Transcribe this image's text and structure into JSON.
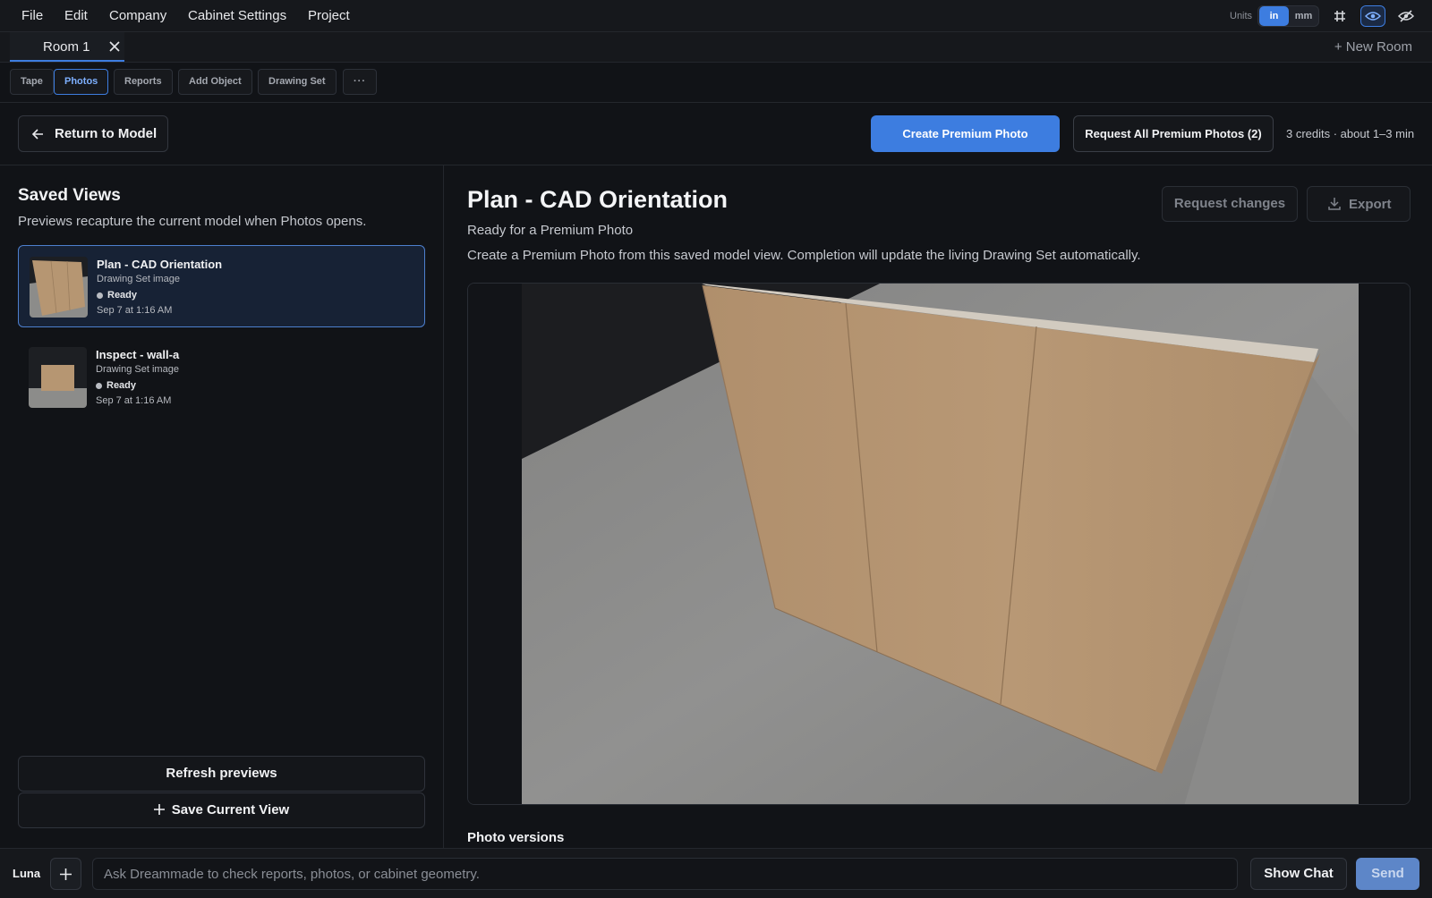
{
  "menu": {
    "items": [
      "File",
      "Edit",
      "Company",
      "Cabinet Settings",
      "Project"
    ]
  },
  "units": {
    "label": "Units",
    "options": [
      "in",
      "mm"
    ],
    "selected": "in"
  },
  "top_icons": [
    "grid-icon",
    "eye-icon",
    "eye-off-icon"
  ],
  "rooms": {
    "active_tab": "Room 1",
    "new_room": "+ New Room"
  },
  "tools": {
    "items": [
      "Tape",
      "Photos",
      "Reports",
      "Add Object",
      "Drawing Set"
    ],
    "active": "Photos",
    "more": "···"
  },
  "actions": {
    "return": "Return to Model",
    "create_premium": "Create Premium Photo",
    "request_all": "Request All Premium Photos (2)",
    "credits": "3 credits · about 1–3 min"
  },
  "saved_views": {
    "title": "Saved Views",
    "subtitle": "Previews recapture the current model when Photos opens.",
    "items": [
      {
        "title": "Plan - CAD Orientation",
        "subtitle": "Drawing Set image",
        "status": "Ready",
        "date": "Sep 7 at 1:16 AM"
      },
      {
        "title": "Inspect - wall-a",
        "subtitle": "Drawing Set image",
        "status": "Ready",
        "date": "Sep 7 at 1:16 AM"
      }
    ],
    "refresh": "Refresh previews",
    "save_current": "Save Current View"
  },
  "detail": {
    "title": "Plan - CAD Orientation",
    "status": "Ready for a Premium Photo",
    "description": "Create a Premium Photo from this saved model view. Completion will update the living Drawing Set automatically.",
    "request_changes": "Request changes",
    "export": "Export",
    "versions_title": "Photo versions"
  },
  "chat": {
    "name": "Luna",
    "placeholder": "Ask Dreammade to check reports, photos, or cabinet geometry.",
    "show_chat": "Show Chat",
    "send": "Send"
  },
  "colors": {
    "accent": "#3d7de0",
    "background": "#111317",
    "cabinet": "#b69672",
    "floor": "#8d8d8b"
  }
}
